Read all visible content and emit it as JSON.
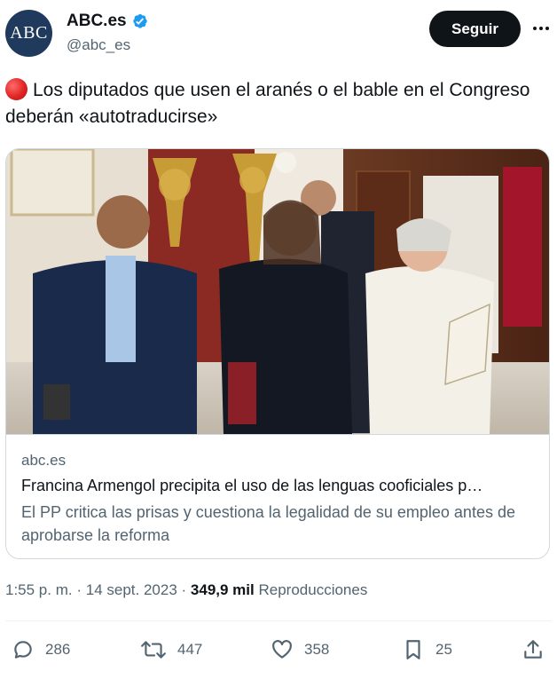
{
  "author": {
    "avatar_text": "ABC",
    "display_name": "ABC.es",
    "handle": "@abc_es",
    "verified_icon": "verified-badge-icon"
  },
  "header": {
    "follow_label": "Seguir",
    "more_icon": "more-icon"
  },
  "tweet": {
    "emoji_icon": "red-circle-icon",
    "text": "Los diputados que usen el aranés o el bable en el Congreso deberán «autotraducirse»"
  },
  "card": {
    "image_icon": "photo-people-congress",
    "domain": "abc.es",
    "title": "Francina Armengol precipita el uso de las lenguas cooficiales p…",
    "description": "El PP critica las prisas y cuestiona la legalidad de su empleo antes de aprobarse la reforma"
  },
  "meta": {
    "time": "1:55 p. m.",
    "separator": "·",
    "date": "14 sept. 2023",
    "separator2": "·",
    "views_count": "349,9 mil",
    "views_label": "Reproducciones"
  },
  "actions": {
    "reply_count": "286",
    "retweet_count": "447",
    "like_count": "358",
    "bookmark_count": "25"
  },
  "colors": {
    "accent": "#1d9bf0",
    "text_primary": "#0f1419",
    "text_secondary": "#536471",
    "border": "#cfd9de"
  }
}
